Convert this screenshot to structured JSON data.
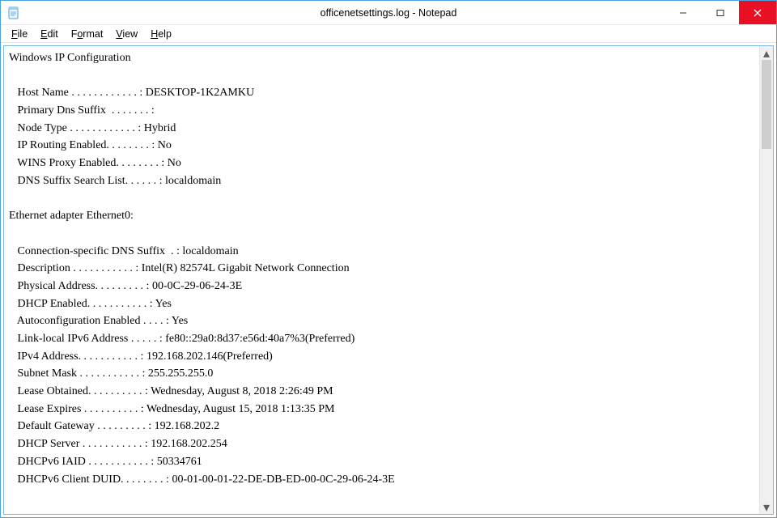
{
  "window": {
    "title": "officenetsettings.log - Notepad"
  },
  "menu": {
    "file": "File",
    "edit": "Edit",
    "format": "Format",
    "view": "View",
    "help": "Help"
  },
  "controls": {
    "minimize": "—",
    "maximize": "▢",
    "close": "✕"
  },
  "scroll": {
    "up": "▴",
    "down": "▾"
  },
  "content": "Windows IP Configuration\n\n   Host Name . . . . . . . . . . . . : DESKTOP-1K2AMKU\n   Primary Dns Suffix  . . . . . . . :\n   Node Type . . . . . . . . . . . . : Hybrid\n   IP Routing Enabled. . . . . . . . : No\n   WINS Proxy Enabled. . . . . . . . : No\n   DNS Suffix Search List. . . . . . : localdomain\n\nEthernet adapter Ethernet0:\n\n   Connection-specific DNS Suffix  . : localdomain\n   Description . . . . . . . . . . . : Intel(R) 82574L Gigabit Network Connection\n   Physical Address. . . . . . . . . : 00-0C-29-06-24-3E\n   DHCP Enabled. . . . . . . . . . . : Yes\n   Autoconfiguration Enabled . . . . : Yes\n   Link-local IPv6 Address . . . . . : fe80::29a0:8d37:e56d:40a7%3(Preferred)\n   IPv4 Address. . . . . . . . . . . : 192.168.202.146(Preferred)\n   Subnet Mask . . . . . . . . . . . : 255.255.255.0\n   Lease Obtained. . . . . . . . . . : Wednesday, August 8, 2018 2:26:49 PM\n   Lease Expires . . . . . . . . . . : Wednesday, August 15, 2018 1:13:35 PM\n   Default Gateway . . . . . . . . . : 192.168.202.2\n   DHCP Server . . . . . . . . . . . : 192.168.202.254\n   DHCPv6 IAID . . . . . . . . . . . : 50334761\n   DHCPv6 Client DUID. . . . . . . . : 00-01-00-01-22-DE-DB-ED-00-0C-29-06-24-3E"
}
